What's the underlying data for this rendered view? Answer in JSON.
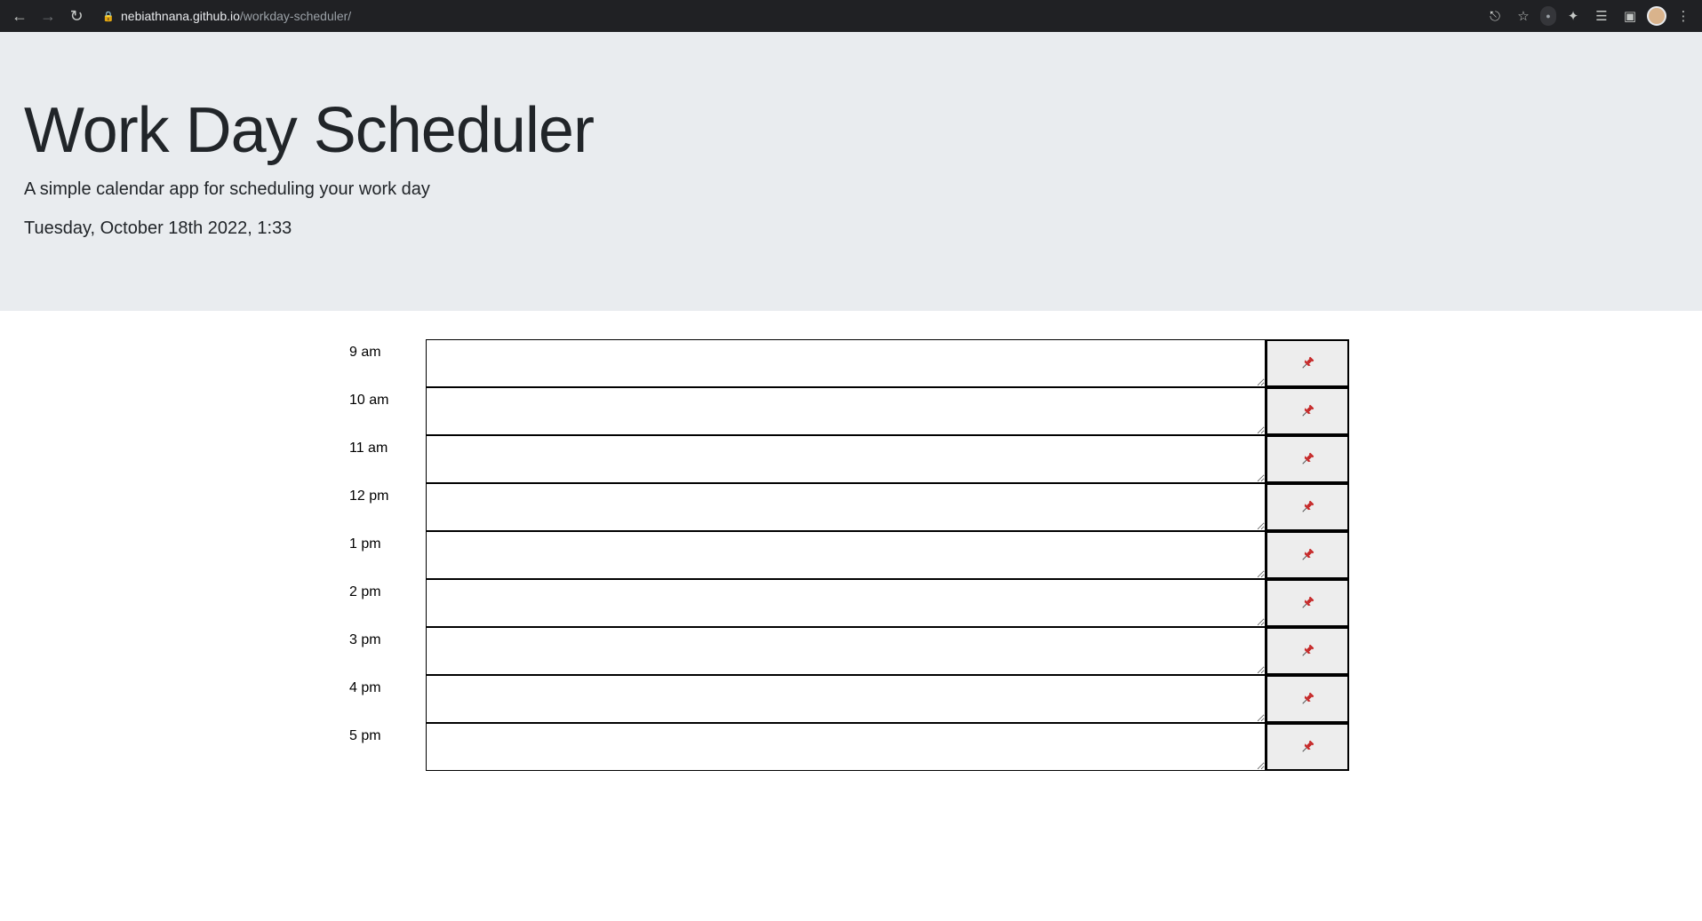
{
  "browser": {
    "url_host": "nebiathnana.github.io",
    "url_path": "/workday-scheduler/"
  },
  "header": {
    "title": "Work Day Scheduler",
    "lead": "A simple calendar app for scheduling your work day",
    "current_day": "Tuesday, October 18th 2022, 1:33"
  },
  "schedule": {
    "hours": [
      "9 am",
      "10 am",
      "11 am",
      "12 pm",
      "1 pm",
      "2 pm",
      "3 pm",
      "4 pm",
      "5 pm"
    ],
    "save_icon": "pushpin-icon",
    "pin_color": "#c62828"
  }
}
